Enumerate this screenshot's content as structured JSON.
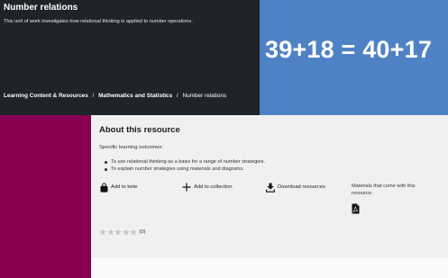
{
  "header": {
    "title": "Number relations",
    "description": "This unit of work investigates how relational thinking is applied to number operations.",
    "breadcrumb": {
      "item1": "Learning Content & Resources",
      "item2": "Mathematics and Statistics",
      "current": "Number relations",
      "separator": "/"
    },
    "equation": "39+18 = 40+17"
  },
  "resource": {
    "section_title": "About this resource",
    "outcomes_label": "Specific learning outcomes:",
    "outcomes": [
      "To use relational thinking as a basis for a range of number strategies.",
      "To explain number strategies using materials and diagrams."
    ],
    "actions": {
      "add_to_kete": "Add to kete",
      "add_to_collection": "Add to collection",
      "download": "Download resources"
    },
    "materials_label": "Materials that come with this resource:",
    "rating": {
      "stars_filled": 0,
      "stars_total": 5,
      "count": "(0)"
    }
  },
  "colors": {
    "hero_dark": "#1f232a",
    "hero_blue": "#4f82c5",
    "side_band": "#870052",
    "panel": "#f0f0f0",
    "star_empty": "#c8c8c8"
  },
  "icons": {
    "kete": "bag-icon",
    "collection": "plus-icon",
    "download": "download-icon",
    "material": "pdf-icon",
    "rating": "star-icon"
  }
}
